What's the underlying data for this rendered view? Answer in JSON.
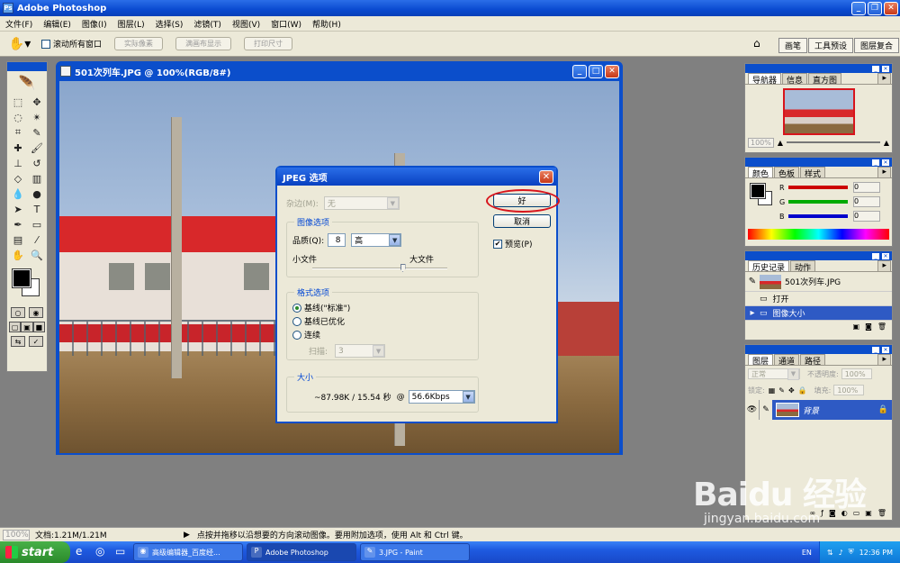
{
  "app": {
    "title": "Adobe Photoshop",
    "icon_letter": "Ps"
  },
  "menu": [
    "文件(F)",
    "编辑(E)",
    "图像(I)",
    "图层(L)",
    "选择(S)",
    "滤镜(T)",
    "视图(V)",
    "窗口(W)",
    "帮助(H)"
  ],
  "options": {
    "scroll_all_label": "滚动所有窗口",
    "actual_pixels": "实际像素",
    "fit_screen": "满画布显示",
    "print_size": "打印尺寸",
    "well_tabs": [
      "画笔",
      "工具预设",
      "图层复合"
    ]
  },
  "document": {
    "title": "501次列车.JPG @ 100%(RGB/8#)"
  },
  "dialog": {
    "title": "JPEG 选项",
    "matte_label": "杂边(M):",
    "matte_value": "无",
    "image_options_label": "图像选项",
    "quality_label": "品质(Q):",
    "quality_value": "8",
    "quality_level": "高",
    "small_file": "小文件",
    "large_file": "大文件",
    "quality_slider_fraction": 0.67,
    "format_options_label": "格式选项",
    "format_options": [
      {
        "label": "基线(\"标准\")",
        "selected": true
      },
      {
        "label": "基线已优化",
        "selected": false
      },
      {
        "label": "连续",
        "selected": false
      }
    ],
    "scans_label": "扫描:",
    "scans_value": "3",
    "size_label": "大小",
    "size_value": "~87.98K / 15.54 秒",
    "at": "@",
    "speed_value": "56.6Kbps",
    "ok_label": "好",
    "cancel_label": "取消",
    "preview_label": "预览(P)",
    "preview_checked": true
  },
  "navigator": {
    "tabs": [
      "导航器",
      "信息",
      "直方图"
    ],
    "zoom": "100%"
  },
  "color": {
    "tabs": [
      "颜色",
      "色板",
      "样式"
    ],
    "channels": [
      {
        "name": "R",
        "color": "#cc0000",
        "value": "0"
      },
      {
        "name": "G",
        "color": "#00aa00",
        "value": "0"
      },
      {
        "name": "B",
        "color": "#0000cc",
        "value": "0"
      }
    ]
  },
  "history": {
    "tabs": [
      "历史记录",
      "动作"
    ],
    "snapshot": "501次列车.JPG",
    "items": [
      {
        "label": "打开",
        "selected": false
      },
      {
        "label": "图像大小",
        "selected": true
      }
    ]
  },
  "layers": {
    "tabs": [
      "图层",
      "通道",
      "路径"
    ],
    "blend_mode": "正常",
    "opacity_label": "不透明度:",
    "opacity_value": "100%",
    "lock_label": "锁定:",
    "fill_label": "填充:",
    "fill_value": "100%",
    "layer_name": "背景"
  },
  "status": {
    "zoom": "100%",
    "doc_info": "文档:1.21M/1.21M",
    "hint": "点按并拖移以沿想要的方向滚动图像。要用附加选项，使用 Alt 和 Ctrl 键。"
  },
  "watermark": {
    "brand": "Baidu 经验",
    "url": "jingyan.baidu.com"
  },
  "taskbar": {
    "start_label": "start",
    "tasks": [
      {
        "label": "高级编辑器_百度经...",
        "active": false
      },
      {
        "label": "Adobe Photoshop",
        "active": true
      },
      {
        "label": "3.JPG - Paint",
        "active": false
      }
    ],
    "lang": "EN",
    "clock": "12:36 PM"
  }
}
